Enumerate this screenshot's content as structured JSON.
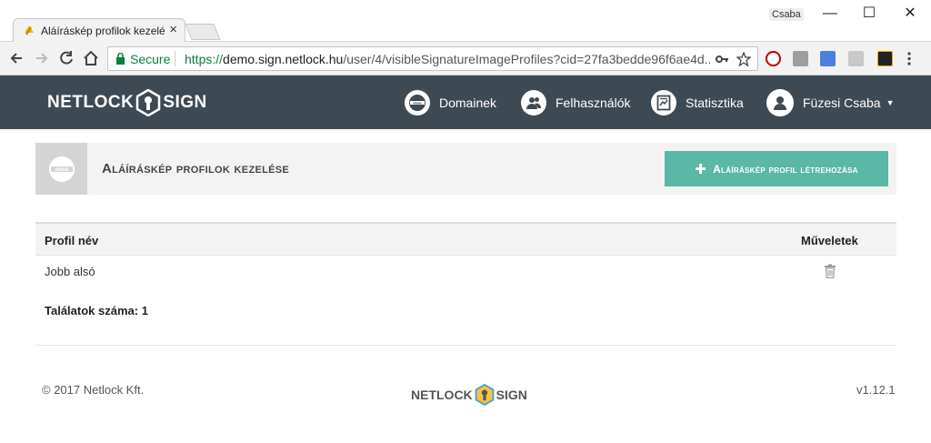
{
  "browser": {
    "tab_title": "Aláíráskép profilok kezelése",
    "profile_name": "Csaba",
    "secure_label": "Secure",
    "url_prefix": "https://",
    "url_domain": "demo.sign.netlock.hu",
    "url_path": "/user/4/visibleSignatureImageProfiles?cid=27fa3bedde96f6ae4d..."
  },
  "nav": {
    "logo_left": "NETLOCK",
    "logo_right": "SIGN",
    "items": [
      {
        "label": "Domainek",
        "icon": "www-icon"
      },
      {
        "label": "Felhasználók",
        "icon": "users-icon"
      },
      {
        "label": "Statisztika",
        "icon": "statistics-icon"
      }
    ],
    "user_label": "Füzesi Csaba"
  },
  "page": {
    "title": "Aláíráskép profilok kezelése",
    "create_button": "Aláíráskép profil létrehozása"
  },
  "table": {
    "headers": [
      "Profil név",
      "Műveletek"
    ],
    "rows": [
      {
        "name": "Jobb alsó"
      }
    ],
    "count_label": "Találatok száma: 1"
  },
  "footer": {
    "copyright": "© 2017 Netlock Kft.",
    "logo_left": "NETLOCK",
    "logo_right": "SIGN",
    "version": "v1.12.1"
  },
  "colors": {
    "navbar": "#3e4a53",
    "accent": "#5bb7a6",
    "secure_green": "#0b8043"
  }
}
